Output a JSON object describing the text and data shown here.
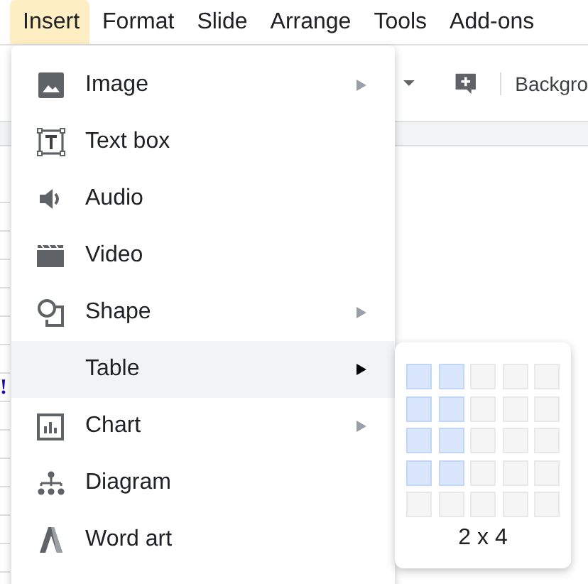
{
  "menubar": [
    {
      "label": "Insert",
      "selected": true
    },
    {
      "label": "Format",
      "selected": false
    },
    {
      "label": "Slide",
      "selected": false
    },
    {
      "label": "Arrange",
      "selected": false
    },
    {
      "label": "Tools",
      "selected": false
    },
    {
      "label": "Add-ons",
      "selected": false
    }
  ],
  "toolbar": {
    "background_button": "Backgro"
  },
  "document": {
    "text_fragment": "!"
  },
  "insert_menu": [
    {
      "label": "Image",
      "submenu": true,
      "selected": false
    },
    {
      "label": "Text box",
      "submenu": false,
      "selected": false
    },
    {
      "label": "Audio",
      "submenu": false,
      "selected": false
    },
    {
      "label": "Video",
      "submenu": false,
      "selected": false
    },
    {
      "label": "Shape",
      "submenu": true,
      "selected": false
    },
    {
      "label": "Table",
      "submenu": true,
      "selected": true
    },
    {
      "label": "Chart",
      "submenu": true,
      "selected": false
    },
    {
      "label": "Diagram",
      "submenu": false,
      "selected": false
    },
    {
      "label": "Word art",
      "submenu": false,
      "selected": false
    }
  ],
  "table_picker": {
    "rows": [
      [
        {
          "selected": true
        },
        {
          "selected": true
        },
        {
          "selected": false
        },
        {
          "selected": false
        },
        {
          "selected": false
        }
      ],
      [
        {
          "selected": true
        },
        {
          "selected": true
        },
        {
          "selected": false
        },
        {
          "selected": false
        },
        {
          "selected": false
        }
      ],
      [
        {
          "selected": true
        },
        {
          "selected": true
        },
        {
          "selected": false
        },
        {
          "selected": false
        },
        {
          "selected": false
        }
      ],
      [
        {
          "selected": true
        },
        {
          "selected": true
        },
        {
          "selected": false
        },
        {
          "selected": false
        },
        {
          "selected": false
        }
      ],
      [
        {
          "selected": false
        },
        {
          "selected": false
        },
        {
          "selected": false
        },
        {
          "selected": false
        },
        {
          "selected": false
        }
      ]
    ],
    "size_label": "2 x 4"
  }
}
